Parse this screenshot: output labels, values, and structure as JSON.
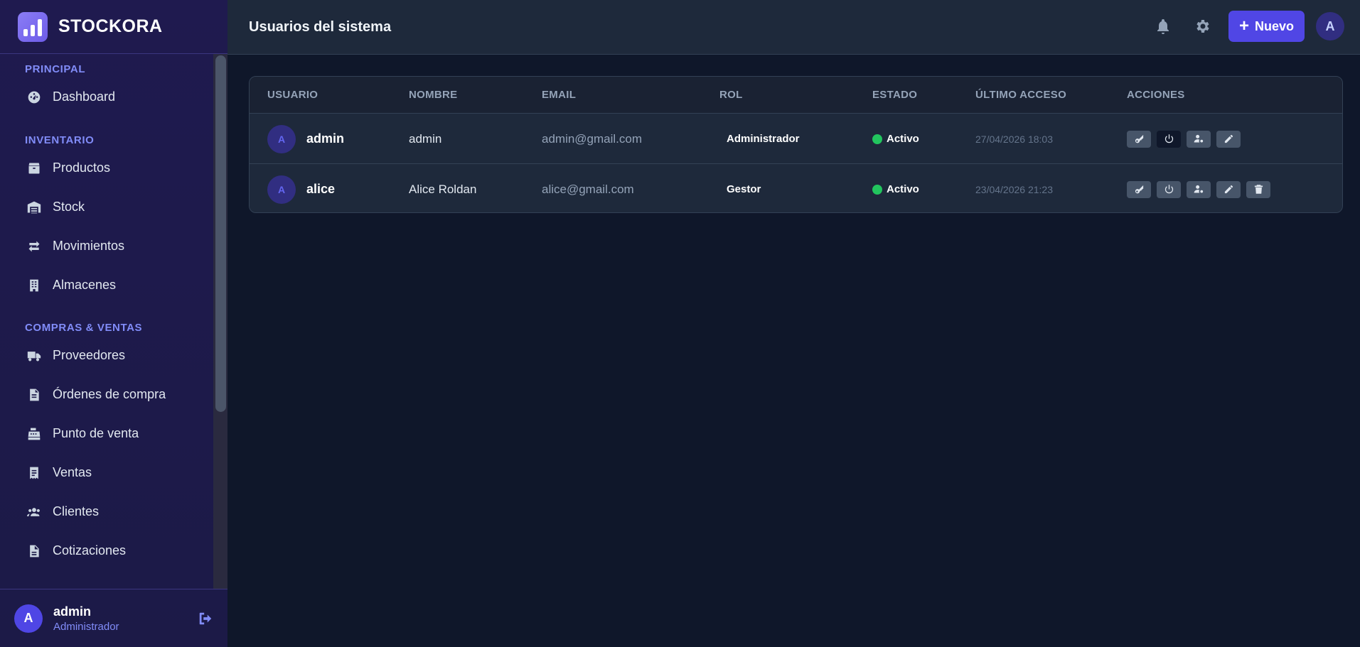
{
  "brand": {
    "name": "STOCKORA"
  },
  "sidebar": {
    "sections": [
      {
        "title": "PRINCIPAL",
        "items": [
          {
            "label": "Dashboard",
            "icon": "gauge-icon"
          }
        ]
      },
      {
        "title": "INVENTARIO",
        "items": [
          {
            "label": "Productos",
            "icon": "box-icon"
          },
          {
            "label": "Stock",
            "icon": "warehouse-icon"
          },
          {
            "label": "Movimientos",
            "icon": "arrows-exchange-icon"
          },
          {
            "label": "Almacenes",
            "icon": "building-icon"
          }
        ]
      },
      {
        "title": "COMPRAS & VENTAS",
        "items": [
          {
            "label": "Proveedores",
            "icon": "truck-icon"
          },
          {
            "label": "Órdenes de compra",
            "icon": "file-invoice-icon"
          },
          {
            "label": "Punto de venta",
            "icon": "cash-register-icon"
          },
          {
            "label": "Ventas",
            "icon": "receipt-icon"
          },
          {
            "label": "Clientes",
            "icon": "users-icon"
          },
          {
            "label": "Cotizaciones",
            "icon": "document-icon"
          }
        ]
      }
    ],
    "user": {
      "initial": "A",
      "name": "admin",
      "role": "Administrador"
    }
  },
  "header": {
    "title": "Usuarios del sistema",
    "new_label": "Nuevo",
    "new_plus": "+",
    "avatar_initial": "A"
  },
  "table": {
    "columns": [
      "USUARIO",
      "NOMBRE",
      "EMAIL",
      "ROL",
      "ESTADO",
      "ÚLTIMO ACCESO",
      "ACCIONES"
    ],
    "rows": [
      {
        "initial": "A",
        "usuario": "admin",
        "nombre": "admin",
        "email": "admin@gmail.com",
        "rol": "Administrador",
        "estado": "Activo",
        "ultimo_acceso": "27/04/2026 18:03",
        "can_delete": false
      },
      {
        "initial": "A",
        "usuario": "alice",
        "nombre": "Alice Roldan",
        "email": "alice@gmail.com",
        "rol": "Gestor",
        "estado": "Activo",
        "ultimo_acceso": "23/04/2026 21:23",
        "can_delete": true
      }
    ]
  },
  "colors": {
    "accent": "#5046e5",
    "active": "#22c55e",
    "sidebar": "#1f1a4f",
    "background": "#0f172a"
  }
}
